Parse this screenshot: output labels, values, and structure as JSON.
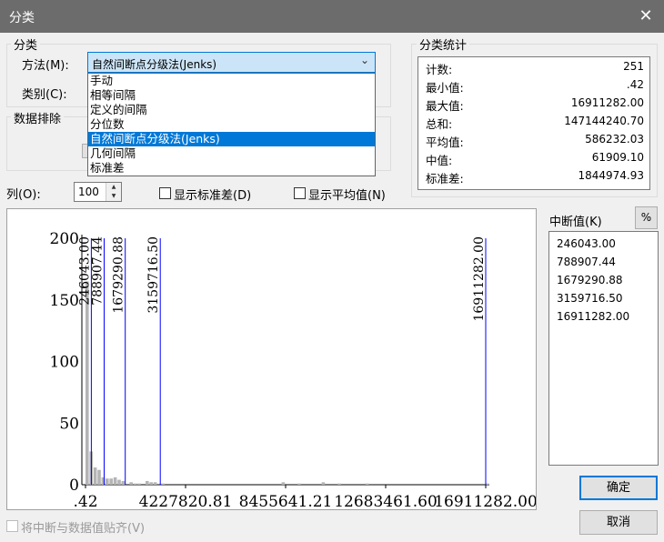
{
  "window": {
    "title": "分类",
    "close_glyph": "✕"
  },
  "classification_group": {
    "label": "分类",
    "method_label": "方法(M):",
    "method_value": "自然间断点分级法(Jenks)",
    "class_label": "类别(C):",
    "method_options": [
      "手动",
      "相等间隔",
      "定义的间隔",
      "分位数",
      "自然间断点分级法(Jenks)",
      "几何间隔",
      "标准差"
    ],
    "selected_index": 4
  },
  "exclusion_group": {
    "label": "数据排除"
  },
  "stats_group": {
    "label": "分类统计",
    "rows": [
      {
        "label": "计数:",
        "value": "251"
      },
      {
        "label": "最小值:",
        "value": ".42"
      },
      {
        "label": "最大值:",
        "value": "16911282.00"
      },
      {
        "label": "总和:",
        "value": "147144240.70"
      },
      {
        "label": "平均值:",
        "value": "586232.03"
      },
      {
        "label": "中值:",
        "value": "61909.10"
      },
      {
        "label": "标准差:",
        "value": "1844974.93"
      }
    ]
  },
  "columns": {
    "label": "列(O):",
    "value": "100"
  },
  "show_std_label": "显示标准差(D)",
  "show_mean_label": "显示平均值(N)",
  "breaks_panel": {
    "label": "中断值(K)",
    "percent_button": "%",
    "values": [
      "246043.00",
      "788907.44",
      "1679290.88",
      "3159716.50",
      "16911282.00"
    ]
  },
  "snap_label": "将中断与数据值贴齐(V)",
  "ok_button": "确定",
  "cancel_button": "取消",
  "chart_data": {
    "type": "bar",
    "y_ticks": [
      "200",
      "150",
      "100",
      "50",
      "0"
    ],
    "x_ticks": [
      ".42",
      "4227820.81",
      "8455641.21",
      "12683461.60",
      "16911282.00"
    ],
    "ylim": [
      0,
      200
    ],
    "xlim": [
      0.42,
      16911282
    ],
    "break_labels": [
      "246043.00",
      "788907.44",
      "1679290.88",
      "3159716.50",
      "16911282.00"
    ],
    "breaks": [
      246043,
      788907.44,
      1679290.88,
      3159716.5,
      16911282
    ],
    "bins": [
      {
        "x": 0.42,
        "value": 165
      },
      {
        "x": 169113,
        "value": 27
      },
      {
        "x": 338226,
        "value": 14
      },
      {
        "x": 507338,
        "value": 12
      },
      {
        "x": 676451,
        "value": 6
      },
      {
        "x": 845564,
        "value": 5
      },
      {
        "x": 1014677,
        "value": 5
      },
      {
        "x": 1183790,
        "value": 6
      },
      {
        "x": 1352903,
        "value": 4
      },
      {
        "x": 1522016,
        "value": 3
      },
      {
        "x": 1860241,
        "value": 2
      },
      {
        "x": 2029354,
        "value": 1
      },
      {
        "x": 2198467,
        "value": 1
      },
      {
        "x": 2536693,
        "value": 3
      },
      {
        "x": 2705806,
        "value": 2
      },
      {
        "x": 2874919,
        "value": 2
      },
      {
        "x": 3213144,
        "value": 1
      },
      {
        "x": 8286528,
        "value": 2
      },
      {
        "x": 8962979,
        "value": 1
      },
      {
        "x": 9978000,
        "value": 2
      },
      {
        "x": 10656000,
        "value": 1
      },
      {
        "x": 11834000,
        "value": 1
      },
      {
        "x": 16911282,
        "value": 1
      }
    ]
  }
}
